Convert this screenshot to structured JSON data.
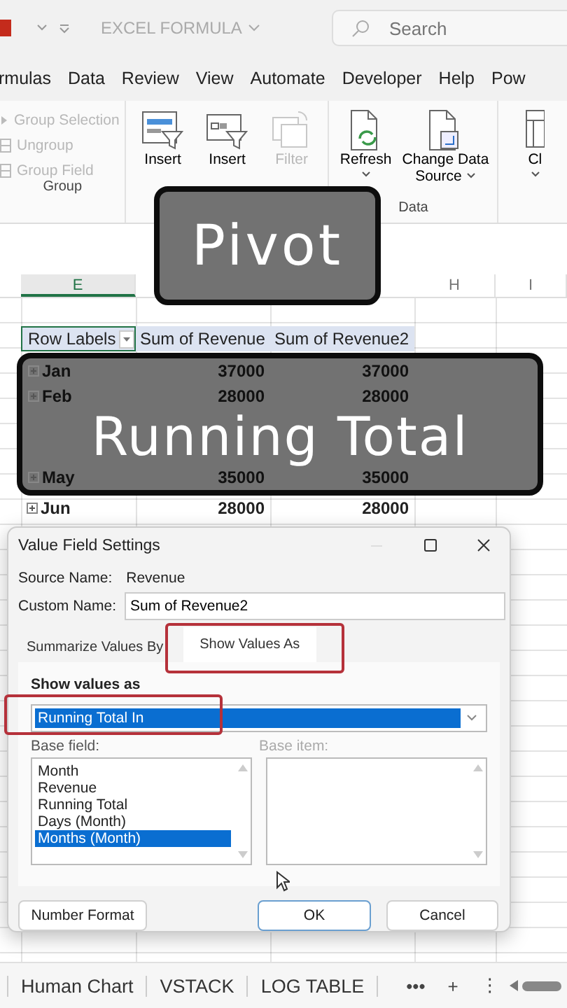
{
  "title_bar": {
    "app_name": "EXCEL FORMULA",
    "search_placeholder": "Search"
  },
  "menu_tabs": [
    "rmulas",
    "Data",
    "Review",
    "View",
    "Automate",
    "Developer",
    "Help",
    "Pow"
  ],
  "ribbon_groups": [
    {
      "label": "Group",
      "kind": "stack",
      "items": [
        {
          "label": "Group Selection",
          "kind": "group-selection",
          "disabled": true
        },
        {
          "label": "Ungroup",
          "kind": "ungroup",
          "disabled": true
        },
        {
          "label": "Group Field",
          "kind": "group-field",
          "disabled": true
        }
      ]
    },
    {
      "kind": "large",
      "items": [
        {
          "lines": [
            "Insert"
          ],
          "kind": "slicer",
          "disabled": false,
          "caret": false
        },
        {
          "lines": [
            "Insert"
          ],
          "kind": "timeline",
          "disabled": false,
          "caret": false
        },
        {
          "lines": [
            "Filter"
          ],
          "kind": "connections",
          "disabled": true,
          "caret": false
        }
      ]
    },
    {
      "label": "Data",
      "kind": "large",
      "items": [
        {
          "lines": [
            "Refresh"
          ],
          "kind": "refresh",
          "disabled": false,
          "caret": true
        },
        {
          "lines": [
            "Change Data",
            "Source"
          ],
          "kind": "change-source",
          "disabled": false,
          "caret": true
        }
      ]
    },
    {
      "kind": "large",
      "items": [
        {
          "lines": [
            "Cl"
          ],
          "kind": "clear",
          "disabled": false,
          "caret": true
        }
      ]
    }
  ],
  "captions": [
    "Pivot",
    "Running Total"
  ],
  "columns": [
    {
      "label": "E",
      "selected": true
    },
    {
      "label": "H",
      "selected": false
    },
    {
      "label": "I",
      "selected": false
    }
  ],
  "pivot_table": {
    "headers": [
      "Row Labels",
      "Sum of Revenue",
      "Sum of Revenue2"
    ],
    "rows": [
      {
        "label": "Jan",
        "values": [
          "37000",
          "37000"
        ],
        "under_caption": true
      },
      {
        "label": "Feb",
        "values": [
          "28000",
          "28000"
        ],
        "under_caption": true
      },
      {
        "label": "May",
        "values": [
          "35000",
          "35000"
        ],
        "under_caption": true
      },
      {
        "label": "Jun",
        "values": [
          "28000",
          "28000"
        ],
        "under_caption": false
      }
    ]
  },
  "dialog": {
    "title": "Value Field Settings",
    "source_label": "Source Name:",
    "source_value": "Revenue",
    "custom_label": "Custom Name:",
    "custom_value": "Sum of Revenue2",
    "tabs": [
      {
        "label": "Summarize Values By",
        "selected": false
      },
      {
        "label": "Show Values As",
        "selected": true
      }
    ],
    "show_values_label": "Show values as",
    "show_values_selected": "Running Total In",
    "base_field_label": "Base field:",
    "base_item_label": "Base item:",
    "base_fields": [
      {
        "label": "Month",
        "selected": false
      },
      {
        "label": "Revenue",
        "selected": false
      },
      {
        "label": "Running Total",
        "selected": false
      },
      {
        "label": "Days (Month)",
        "selected": false
      },
      {
        "label": "Months (Month)",
        "selected": true
      }
    ],
    "buttons": [
      {
        "label": "Number Format",
        "kind": "plain"
      },
      {
        "label": "OK",
        "kind": "default"
      },
      {
        "label": "Cancel",
        "kind": "plain"
      }
    ]
  },
  "sheet_tabs": [
    "Human Chart",
    "VSTACK",
    "LOG TABLE"
  ],
  "sheet_tab_controls": [
    "•••",
    "+",
    "⋮"
  ]
}
